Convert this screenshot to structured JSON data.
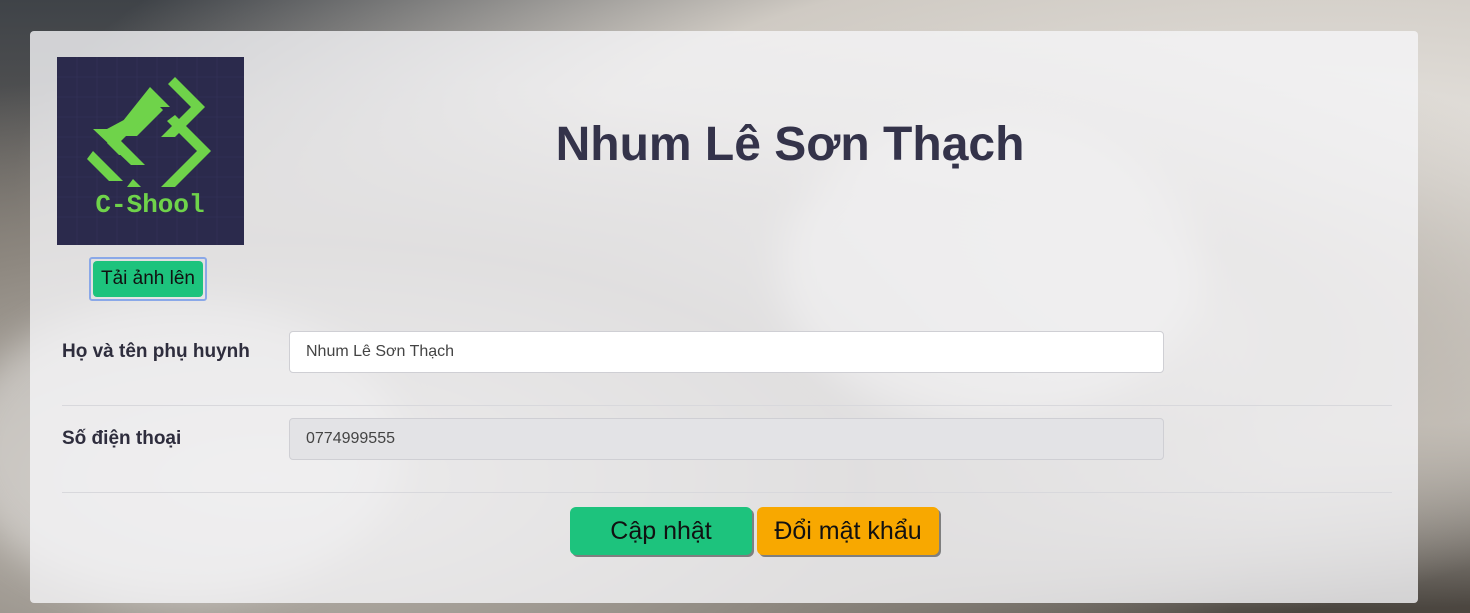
{
  "profile": {
    "logo_text": "C-Shool",
    "upload_label": "Tải ảnh lên",
    "title": "Nhum Lê Sơn Thạch"
  },
  "form": {
    "name_label": "Họ và tên phụ huynh",
    "name_value": "Nhum Lê Sơn Thạch",
    "phone_label": "Số điện thoại",
    "phone_value": "0774999555"
  },
  "actions": {
    "update_label": "Cập nhật",
    "change_password_label": "Đổi mật khẩu"
  },
  "colors": {
    "primary_green": "#1dc37d",
    "accent_orange": "#f8a800",
    "logo_bg": "#2b2a4c",
    "logo_green": "#6fd34a"
  }
}
